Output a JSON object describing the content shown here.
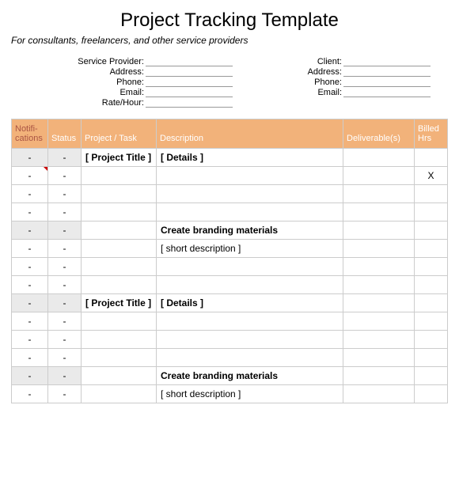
{
  "title": "Project Tracking Template",
  "subtitle": "For consultants, freelancers, and other service providers",
  "provider_labels": [
    "Service Provider:",
    "Address:",
    "Phone:",
    "Email:",
    "Rate/Hour:"
  ],
  "client_labels": [
    "Client:",
    "Address:",
    "Phone:",
    "Email:"
  ],
  "headers": {
    "notif": "Notifi-cations",
    "status": "Status",
    "task": "Project / Task",
    "desc": "Description",
    "deliv": "Deliverable(s)",
    "hrs": "Billed Hrs"
  },
  "rows": [
    {
      "notif": "-",
      "status": "-",
      "task": "[ Project Title ]",
      "desc": "[ Details ]",
      "deliv": "",
      "hrs": "",
      "shaded": true,
      "bold": true,
      "marker": false
    },
    {
      "notif": "-",
      "status": "-",
      "task": "",
      "desc": "",
      "deliv": "",
      "hrs": "X",
      "shaded": false,
      "bold": false,
      "marker": true
    },
    {
      "notif": "-",
      "status": "-",
      "task": "",
      "desc": "",
      "deliv": "",
      "hrs": "",
      "shaded": false,
      "bold": false,
      "marker": false
    },
    {
      "notif": "-",
      "status": "-",
      "task": "",
      "desc": "",
      "deliv": "",
      "hrs": "",
      "shaded": false,
      "bold": false,
      "marker": false
    },
    {
      "notif": "-",
      "status": "-",
      "task": "",
      "desc": "Create branding materials",
      "deliv": "",
      "hrs": "",
      "shaded": true,
      "bold": true,
      "marker": false
    },
    {
      "notif": "-",
      "status": "-",
      "task": "",
      "desc": "[ short description ]",
      "deliv": "",
      "hrs": "",
      "shaded": false,
      "bold": false,
      "marker": false
    },
    {
      "notif": "-",
      "status": "-",
      "task": "",
      "desc": "",
      "deliv": "",
      "hrs": "",
      "shaded": false,
      "bold": false,
      "marker": false
    },
    {
      "notif": "-",
      "status": "-",
      "task": "",
      "desc": "",
      "deliv": "",
      "hrs": "",
      "shaded": false,
      "bold": false,
      "marker": false
    },
    {
      "notif": "-",
      "status": "-",
      "task": "[ Project Title ]",
      "desc": "[ Details ]",
      "deliv": "",
      "hrs": "",
      "shaded": true,
      "bold": true,
      "marker": false
    },
    {
      "notif": "-",
      "status": "-",
      "task": "",
      "desc": "",
      "deliv": "",
      "hrs": "",
      "shaded": false,
      "bold": false,
      "marker": false
    },
    {
      "notif": "-",
      "status": "-",
      "task": "",
      "desc": "",
      "deliv": "",
      "hrs": "",
      "shaded": false,
      "bold": false,
      "marker": false
    },
    {
      "notif": "-",
      "status": "-",
      "task": "",
      "desc": "",
      "deliv": "",
      "hrs": "",
      "shaded": false,
      "bold": false,
      "marker": false
    },
    {
      "notif": "-",
      "status": "-",
      "task": "",
      "desc": "Create branding materials",
      "deliv": "",
      "hrs": "",
      "shaded": true,
      "bold": true,
      "marker": false
    },
    {
      "notif": "-",
      "status": "-",
      "task": "",
      "desc": "[ short description ]",
      "deliv": "",
      "hrs": "",
      "shaded": false,
      "bold": false,
      "marker": false
    }
  ]
}
